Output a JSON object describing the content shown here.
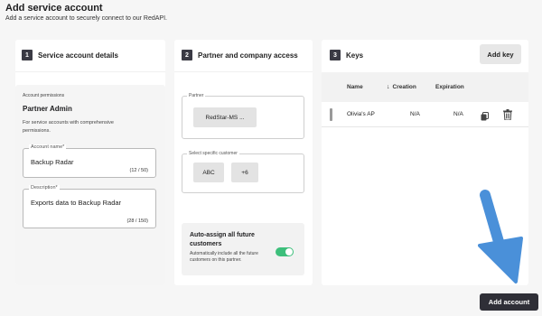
{
  "header": {
    "title": "Add service account",
    "subtitle": "Add a service account to securely connect to our RedAPI."
  },
  "steps": [
    {
      "number": "1",
      "title": "Service account details"
    },
    {
      "number": "2",
      "title": "Partner and company access"
    },
    {
      "number": "3",
      "title": "Keys"
    }
  ],
  "details": {
    "permissions_caption": "Account permissions",
    "role": "Partner Admin",
    "role_description": "For service accounts with comprehensive permissions.",
    "account_name": {
      "label": "Account name*",
      "value": "Backup Radar",
      "counter": "(12 / 50)"
    },
    "description": {
      "label": "Description*",
      "value": "Exports data to Backup Radar",
      "counter": "(28 / 150)"
    }
  },
  "access": {
    "partner_label": "Partner",
    "partner_value": "RedStar-MS ...",
    "customer_label": "Select specific customer",
    "customer_chips": [
      "ABC",
      "+6"
    ],
    "auto_assign_title": "Auto-assign all future customers",
    "auto_assign_description": "Automatically include all the future customers on this partner.",
    "auto_assign_enabled": true
  },
  "keys": {
    "add_key_label": "Add key",
    "columns": [
      "Name",
      "Creation",
      "Expiration"
    ],
    "sort_icon": "arrow-down-icon",
    "rows": [
      {
        "name": "Olivia's AP",
        "creation": "N/A",
        "expiration": "N/A"
      }
    ]
  },
  "footer": {
    "add_account_label": "Add account"
  },
  "colors": {
    "toggle_on": "#3dbf7b",
    "primary_button": "#2f2f37",
    "annotation_arrow": "#4a90d9"
  }
}
